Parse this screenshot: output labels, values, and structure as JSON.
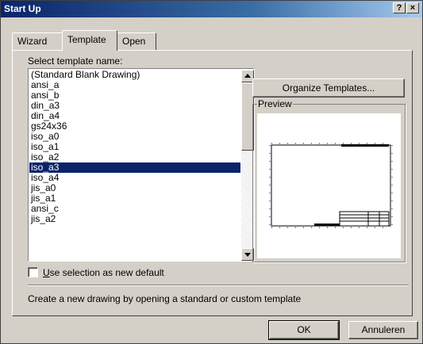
{
  "window": {
    "title": "Start Up",
    "help_glyph": "?",
    "close_glyph": "×"
  },
  "tabs": [
    {
      "label": "Wizard"
    },
    {
      "label": "Template"
    },
    {
      "label": "Open"
    }
  ],
  "template_panel": {
    "select_label": "Select template name:",
    "items": [
      "(Standard Blank Drawing)",
      "ansi_a",
      "ansi_b",
      "din_a3",
      "din_a4",
      "gs24x36",
      "iso_a0",
      "iso_a1",
      "iso_a2",
      "iso_a3",
      "iso_a4",
      "jis_a0",
      "jis_a1",
      "ansi_c",
      "jis_a2"
    ],
    "selected_item": "iso_a3",
    "organize_button": "Organize Templates...",
    "preview_label": "Preview",
    "checkbox_label": "Use selection as new default",
    "checkbox_checked": false,
    "description": "Create a new drawing by opening a standard or custom template"
  },
  "buttons": {
    "ok": "OK",
    "cancel": "Annuleren"
  },
  "colors": {
    "title_bar": "#0a246a",
    "selection": "#0a246a",
    "face": "#d4d0c8"
  }
}
